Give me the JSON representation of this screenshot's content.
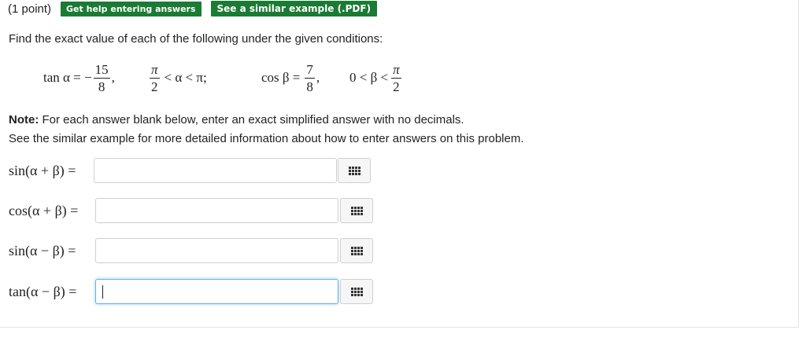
{
  "header": {
    "points": "(1 point)",
    "help_button": "Get help entering answers",
    "example_button": "See a similar example (.PDF)"
  },
  "prompt": "Find the exact value of each of the following under the given conditions:",
  "conditions": {
    "tan_lhs": "tan α = −",
    "tan_num": "15",
    "tan_den": "8",
    "comma1": ",",
    "alpha_pi_num": "π",
    "alpha_pi_den": "2",
    "alpha_range": "< α < π;",
    "cos_lhs": "cos β =",
    "cos_num": "7",
    "cos_den": "8",
    "comma2": ",",
    "beta_range": "0 < β <",
    "beta_pi_num": "π",
    "beta_pi_den": "2"
  },
  "note": {
    "bold": "Note:",
    "line1": "For each answer blank below, enter an exact simplified answer with no decimals.",
    "line2": "See the similar example for more detailed information about how to enter answers on this problem."
  },
  "questions": [
    {
      "label": "sin(α + β) =",
      "value": ""
    },
    {
      "label": "cos(α + β) =",
      "value": ""
    },
    {
      "label": "sin(α − β) =",
      "value": ""
    },
    {
      "label": "tan(α − β) =",
      "value": ""
    }
  ],
  "icons": {
    "palette": "grid-palette-icon"
  },
  "colors": {
    "button_bg": "#1b7a34",
    "focus": "#66afe9"
  }
}
